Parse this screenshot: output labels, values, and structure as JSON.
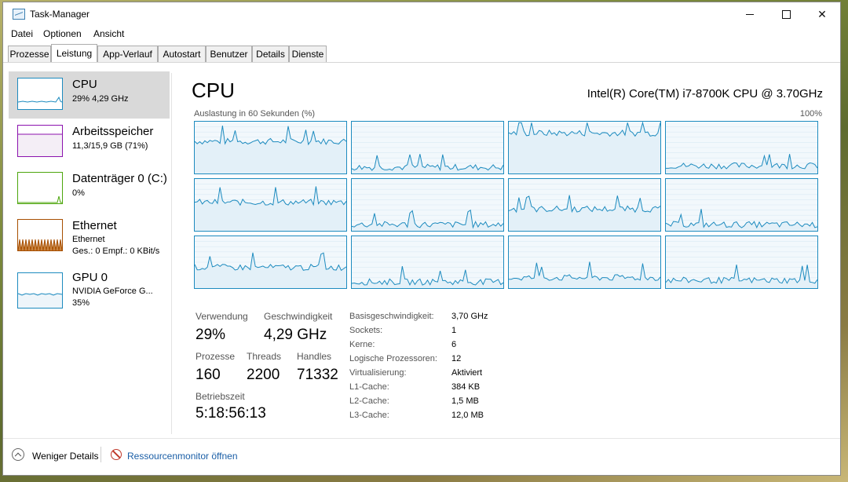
{
  "window": {
    "title": "Task-Manager"
  },
  "menu": [
    "Datei",
    "Optionen",
    "Ansicht"
  ],
  "tabs": [
    "Prozesse",
    "Leistung",
    "App-Verlauf",
    "Autostart",
    "Benutzer",
    "Details",
    "Dienste"
  ],
  "active_tab": "Leistung",
  "sidebar": [
    {
      "title": "CPU",
      "line1": "29% 4,29 GHz",
      "selected": true
    },
    {
      "title": "Arbeitsspeicher",
      "line1": "11,3/15,9 GB (71%)"
    },
    {
      "title": "Datenträger 0 (C:)",
      "line1": "0%"
    },
    {
      "title": "Ethernet",
      "line1": "Ethernet",
      "line2": "Ges.: 0 Empf.: 0 KBit/s"
    },
    {
      "title": "GPU 0",
      "line1": "NVIDIA GeForce G...",
      "line2": "35%"
    }
  ],
  "cpu": {
    "title": "CPU",
    "model": "Intel(R) Core(TM) i7-8700K CPU @ 3.70GHz",
    "graph_label": "Auslastung in 60 Sekunden (%)",
    "graph_max": "100%",
    "core_levels": [
      0.62,
      0.12,
      0.78,
      0.15,
      0.55,
      0.12,
      0.42,
      0.12,
      0.4,
      0.12,
      0.2,
      0.15
    ]
  },
  "stats": {
    "verwendung": {
      "label": "Verwendung",
      "value": "29%"
    },
    "geschwindigkeit": {
      "label": "Geschwindigkeit",
      "value": "4,29 GHz"
    },
    "prozesse": {
      "label": "Prozesse",
      "value": "160"
    },
    "threads": {
      "label": "Threads",
      "value": "2200"
    },
    "handles": {
      "label": "Handles",
      "value": "71332"
    },
    "betriebszeit": {
      "label": "Betriebszeit",
      "value": "5:18:56:13"
    }
  },
  "details": [
    {
      "label": "Basisgeschwindigkeit:",
      "value": "3,70 GHz"
    },
    {
      "label": "Sockets:",
      "value": "1"
    },
    {
      "label": "Kerne:",
      "value": "6"
    },
    {
      "label": "Logische Prozessoren:",
      "value": "12"
    },
    {
      "label": "Virtualisierung:",
      "value": "Aktiviert"
    },
    {
      "label": "L1-Cache:",
      "value": "384 KB"
    },
    {
      "label": "L2-Cache:",
      "value": "1,5 MB"
    },
    {
      "label": "L3-Cache:",
      "value": "12,0 MB"
    }
  ],
  "footer": {
    "less": "Weniger Details",
    "resmon": "Ressourcenmonitor öffnen"
  },
  "colors": {
    "cpu": "#1d8bbf",
    "memory": "#8b12ae",
    "disk": "#4da60c",
    "ethernet": "#a74f01",
    "gpu": "#1d8bbf"
  }
}
